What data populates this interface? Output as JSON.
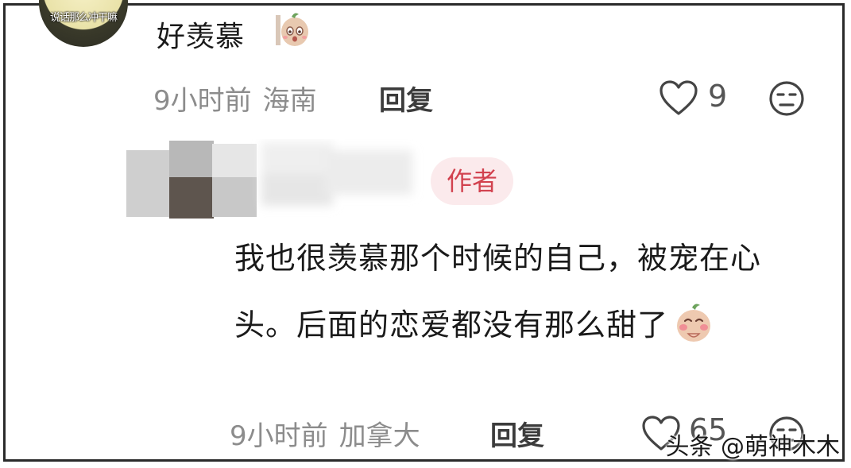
{
  "comment": {
    "avatar_caption": "说话那么冲干嘛",
    "text": "好羡慕",
    "emoji": "shy-sticker-emoji",
    "time": "9小时前",
    "location": "海南",
    "reply_label": "回复",
    "like_count": "9"
  },
  "reply": {
    "author_badge": "作者",
    "text": "我也很羡慕那个时候的自己，被宠在心头。后面的恋爱都没有那么甜了",
    "emoji": "happy-sticker-emoji",
    "time": "9小时前",
    "location": "加拿大",
    "reply_label": "回复",
    "like_count": "65"
  },
  "watermark": "头条 @萌神木木",
  "colors": {
    "badge_bg": "#fbeaec",
    "badge_text": "#d2424f",
    "meta_text": "#8c8c8c"
  }
}
